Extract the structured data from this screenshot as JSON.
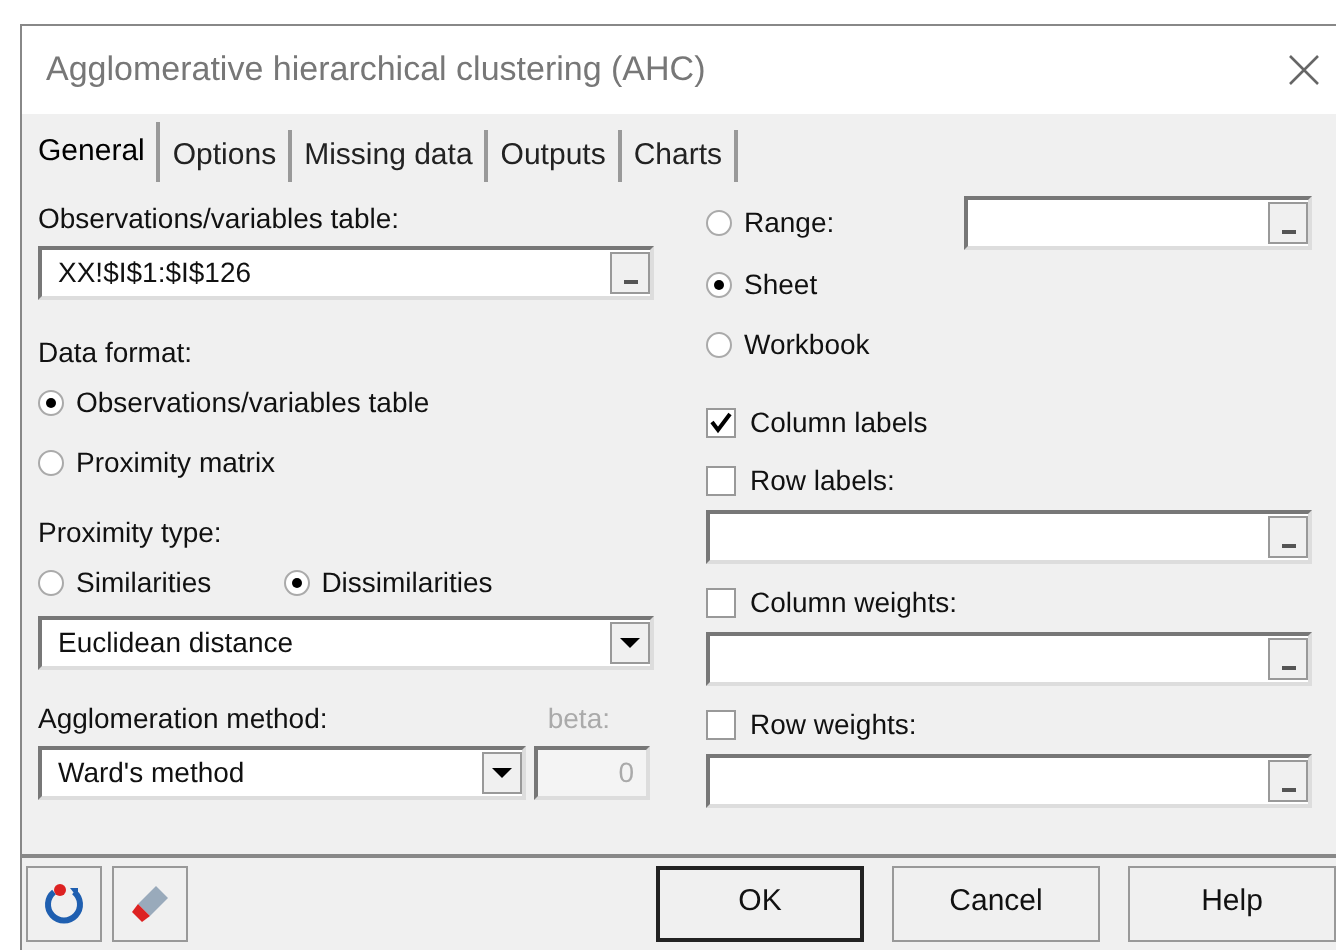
{
  "window": {
    "title": "Agglomerative hierarchical clustering (AHC)"
  },
  "tabs": [
    {
      "label": "General",
      "selected": true
    },
    {
      "label": "Options",
      "selected": false
    },
    {
      "label": "Missing data",
      "selected": false
    },
    {
      "label": "Outputs",
      "selected": false
    },
    {
      "label": "Charts",
      "selected": false
    }
  ],
  "table": {
    "label": "Observations/variables table:",
    "value": "XX!$I$1:$I$126"
  },
  "data_format": {
    "label": "Data format:",
    "options": [
      {
        "label": "Observations/variables table",
        "selected": true
      },
      {
        "label": "Proximity matrix",
        "selected": false
      }
    ]
  },
  "proximity_type": {
    "label": "Proximity type:",
    "options": [
      {
        "label": "Similarities",
        "selected": false
      },
      {
        "label": "Dissimilarities",
        "selected": true
      }
    ],
    "measure": "Euclidean distance"
  },
  "agglomeration": {
    "label": "Agglomeration method:",
    "value": "Ward's method"
  },
  "beta": {
    "label": "beta:",
    "value": "0",
    "disabled": true
  },
  "range_options": [
    {
      "label": "Range:",
      "selected": false
    },
    {
      "label": "Sheet",
      "selected": true
    },
    {
      "label": "Workbook",
      "selected": false
    }
  ],
  "checks": [
    {
      "kind": "plain",
      "label": "Column labels",
      "checked": true
    },
    {
      "kind": "field",
      "label": "Row labels:",
      "checked": false
    },
    {
      "kind": "field",
      "label": "Column weights:",
      "checked": false
    },
    {
      "kind": "field",
      "label": "Row weights:",
      "checked": false
    }
  ],
  "buttons": [
    {
      "label": "OK",
      "default": true
    },
    {
      "label": "Cancel",
      "default": false
    },
    {
      "label": "Help",
      "default": false
    }
  ]
}
